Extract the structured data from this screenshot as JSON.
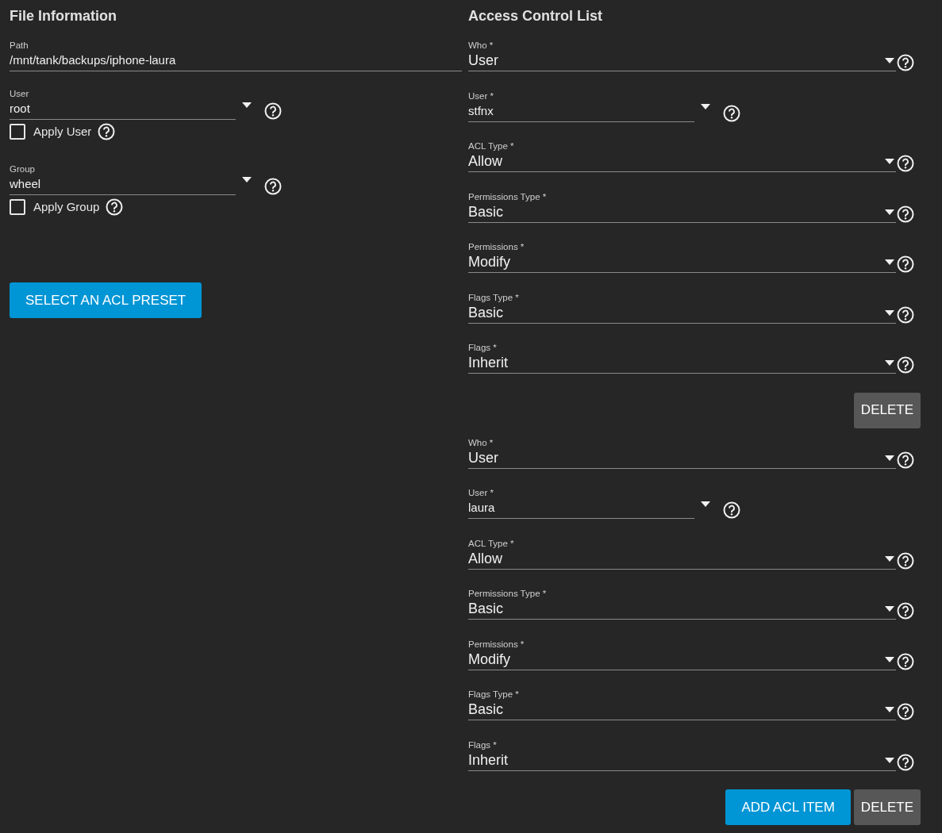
{
  "file_information": {
    "title": "File Information",
    "path": {
      "label": "Path",
      "value": "/mnt/tank/backups/iphone-laura"
    },
    "owners": [
      {
        "label": "User",
        "value": "root",
        "apply_label": "Apply User",
        "apply_checked": false
      },
      {
        "label": "Group",
        "value": "wheel",
        "apply_label": "Apply Group",
        "apply_checked": false
      }
    ],
    "preset_button": "SELECT AN ACL PRESET"
  },
  "access_control_list": {
    "title": "Access Control List",
    "items": [
      {
        "fields": [
          {
            "kind": "select",
            "label": "Who *",
            "value": "User"
          },
          {
            "kind": "combo",
            "label": "User *",
            "value": "stfnx"
          },
          {
            "kind": "select",
            "label": "ACL Type *",
            "value": "Allow"
          },
          {
            "kind": "select",
            "label": "Permissions Type *",
            "value": "Basic"
          },
          {
            "kind": "select",
            "label": "Permissions *",
            "value": "Modify"
          },
          {
            "kind": "select",
            "label": "Flags Type *",
            "value": "Basic"
          },
          {
            "kind": "select",
            "label": "Flags *",
            "value": "Inherit"
          }
        ],
        "delete_button": "DELETE"
      },
      {
        "fields": [
          {
            "kind": "select",
            "label": "Who *",
            "value": "User"
          },
          {
            "kind": "combo",
            "label": "User *",
            "value": "laura"
          },
          {
            "kind": "select",
            "label": "ACL Type *",
            "value": "Allow"
          },
          {
            "kind": "select",
            "label": "Permissions Type *",
            "value": "Basic"
          },
          {
            "kind": "select",
            "label": "Permissions *",
            "value": "Modify"
          },
          {
            "kind": "select",
            "label": "Flags Type *",
            "value": "Basic"
          },
          {
            "kind": "select",
            "label": "Flags *",
            "value": "Inherit"
          }
        ],
        "delete_button": "DELETE"
      }
    ],
    "add_button": "ADD ACL ITEM"
  }
}
